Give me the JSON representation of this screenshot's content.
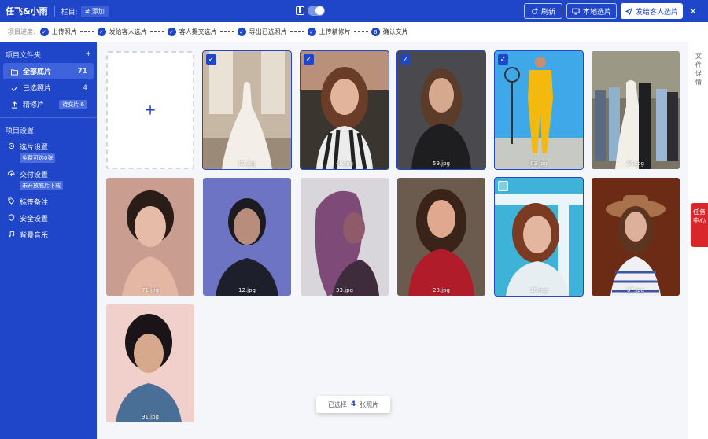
{
  "header": {
    "project_name": "任飞&小雨",
    "column_label": "栏目:",
    "add_tag": "# 添加",
    "refresh_label": "刷新",
    "local_select_label": "本地选片",
    "send_label": "发给客人选片",
    "close_label": "×"
  },
  "progress": {
    "label": "项目进度:",
    "steps": [
      {
        "label": "上传照片",
        "marker": "✓"
      },
      {
        "label": "发给客人选片",
        "marker": "✓"
      },
      {
        "label": "客人提交选片",
        "marker": "✓"
      },
      {
        "label": "导出已选照片",
        "marker": "✓"
      },
      {
        "label": "上传精修片",
        "marker": "✓"
      },
      {
        "label": "确认交片",
        "marker": "6"
      }
    ]
  },
  "sidebar": {
    "folder_section": "项目文件夹",
    "folder_add": "+",
    "items": [
      {
        "label": "全部底片",
        "count": "71",
        "active": true
      },
      {
        "label": "已选照片",
        "count": "4"
      },
      {
        "label": "精修片",
        "badge": "待交片 6"
      }
    ],
    "settings_section": "项目设置",
    "settings": [
      {
        "label": "选片设置",
        "badge": "免费可选0张"
      },
      {
        "label": "交付设置",
        "badge": "未开放底片下载"
      },
      {
        "label": "标签备注"
      },
      {
        "label": "安全设置"
      },
      {
        "label": "背景音乐"
      }
    ]
  },
  "photos": [
    {
      "name": "62.jpg",
      "checked": true
    },
    {
      "name": "49.jpg",
      "checked": true
    },
    {
      "name": "59.jpg",
      "checked": true
    },
    {
      "name": "63.jpg",
      "checked": true
    },
    {
      "name": "65.jpg"
    },
    {
      "name": "71.jpg"
    },
    {
      "name": "12.jpg"
    },
    {
      "name": "33.jpg"
    },
    {
      "name": "28.jpg"
    },
    {
      "name": "15.jpg",
      "hover": true
    },
    {
      "name": "07.jpg"
    },
    {
      "name": "91.jpg"
    }
  ],
  "upload_plus": "+",
  "rail": {
    "file_details": "文件详情",
    "task_center": "任务中心"
  },
  "toast": {
    "prefix": "已选择",
    "count": "4",
    "suffix": "张照片"
  },
  "colors": {
    "brand": "#1f45c8",
    "task": "#d9262a"
  }
}
